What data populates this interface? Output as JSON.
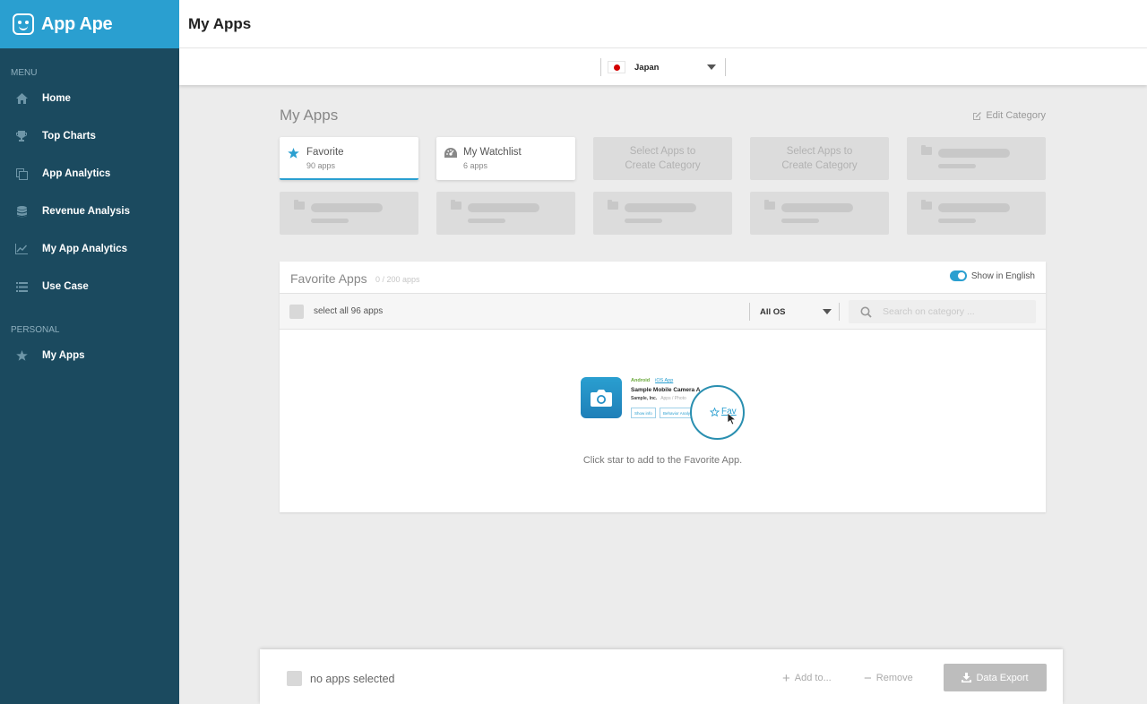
{
  "brand": {
    "name": "App Ape"
  },
  "sidebar": {
    "menu_heading": "MENU",
    "items": [
      {
        "label": "Home",
        "icon": "home-icon"
      },
      {
        "label": "Top Charts",
        "icon": "trophy-icon"
      },
      {
        "label": "App Analytics",
        "icon": "copy-icon"
      },
      {
        "label": "Revenue Analysis",
        "icon": "database-icon"
      },
      {
        "label": "My App Analytics",
        "icon": "line-chart-icon"
      },
      {
        "label": "Use Case",
        "icon": "list-icon"
      }
    ],
    "personal_heading": "PERSONAL",
    "personal_items": [
      {
        "label": "My Apps",
        "icon": "star-icon"
      }
    ]
  },
  "header": {
    "title": "My Apps"
  },
  "country": {
    "selected": "Japan"
  },
  "main": {
    "section_title": "My Apps",
    "edit_category": "Edit Category",
    "categories": [
      {
        "name": "Favorite",
        "count": "90 apps"
      },
      {
        "name": "My Watchlist",
        "count": "6 apps"
      }
    ],
    "empty_slot_line1": "Select Apps to",
    "empty_slot_line2": "Create Category"
  },
  "panel": {
    "title": "Favorite Apps",
    "count": "0 / 200 apps",
    "toggle_label": "Show in English",
    "select_all": "select all 96 apps",
    "os_filter": "All OS",
    "search_placeholder": "Search on category ...",
    "illustration": {
      "os_android": "Android",
      "os_ios": "iOS App",
      "app_title": "Sample Mobile Camera A",
      "publisher": "Sample, Inc.",
      "publisher_meta": "Apps / Photo",
      "btn1": "Show info",
      "btn2": "Behavior Analysis",
      "fav_label": "Fav"
    },
    "hint": "Click star to add to the Favorite App."
  },
  "footer": {
    "selection": "no apps selected",
    "add": "Add to...",
    "remove": "Remove",
    "export": "Data Export"
  },
  "colors": {
    "sidebar_bg": "#1b4a5f",
    "brand_bg": "#2a9fd0",
    "accent": "#2a9fd0"
  }
}
